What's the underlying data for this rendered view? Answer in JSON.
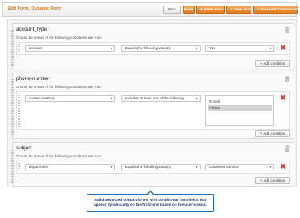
{
  "header": {
    "title": "Edit Form: Dynamic Form",
    "back_label": "Back",
    "reset_label": "Reset",
    "delete_label": "Delete Form",
    "save_label": "Save Form",
    "save_edit_label": "Save And Continue Edit"
  },
  "fields": [
    {
      "name": "account_type",
      "hint": "Should be shown if the following conditions are true:",
      "condition": {
        "field": "account",
        "operator": "Equals the following value(s)",
        "value": "Yes"
      },
      "add_label": "Add condition"
    },
    {
      "name": "phone-number",
      "hint": "Should be shown if the following conditions are true:",
      "condition": {
        "field": "contact-method",
        "operator": "Includes at least one of the following",
        "options": [
          "E-mail",
          "Phone"
        ],
        "selected": "Phone"
      },
      "add_label": "Add condition"
    },
    {
      "name": "subject",
      "hint": "Should be shown if the following conditions are true:",
      "condition": {
        "field": "department",
        "operator": "Equals the following value(s)",
        "value": "Customer Service"
      },
      "add_label": "Add condition"
    }
  ],
  "tooltip": {
    "line1": "Build advanced contact forms with conditional form fields that",
    "line2": "appear dynamically on the front-end based on the user's input."
  },
  "colors": {
    "accent": "#e47d20",
    "title": "#e07b1a",
    "delete": "#d24b40",
    "tooltip_border": "#1f6fc8"
  }
}
